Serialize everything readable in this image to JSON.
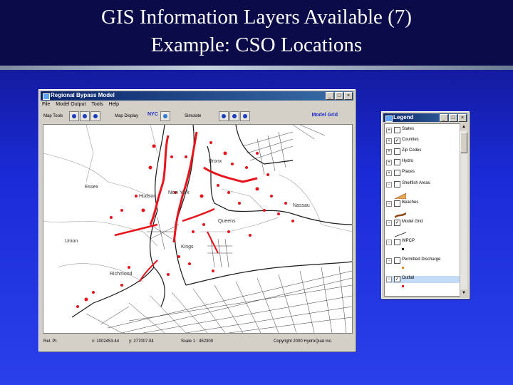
{
  "slide": {
    "title_line1": "GIS Information Layers Available (7)",
    "title_line2": "Example: CSO Locations"
  },
  "app": {
    "window_title": "Regional Bypass Model",
    "menu": [
      "File",
      "Model Output",
      "Tools",
      "Help"
    ],
    "toolbar": {
      "map_tools_label": "Map Tools",
      "map_display_label": "Map Display",
      "map_display_value": "NYC",
      "simulate_label": "Simulate",
      "model_grid": "Model Grid"
    },
    "map_labels": [
      "Bronx",
      "Essex",
      "Hudson",
      "New York",
      "Nassau",
      "Queens",
      "Union",
      "Kings",
      "Richmond"
    ],
    "status": {
      "left": "Rel. Pt.",
      "x": "x: 1002453.44",
      "y": "y: 277007.04",
      "scale": "Scale 1 : 452300",
      "copyright": "Copyright 2000 HydroQual Inc."
    }
  },
  "legend": {
    "title": "Legend",
    "items": [
      {
        "label": "States",
        "checked": false,
        "expanded": false
      },
      {
        "label": "Counties",
        "checked": true,
        "expanded": false
      },
      {
        "label": "Zip Codes",
        "checked": false,
        "expanded": false
      },
      {
        "label": "Hydro",
        "checked": false,
        "expanded": false
      },
      {
        "label": "Places",
        "checked": false,
        "expanded": false
      },
      {
        "label": "Shellfish Areas",
        "checked": false,
        "expanded": true
      },
      {
        "label": "Beaches",
        "checked": false,
        "expanded": true
      },
      {
        "label": "Model Grid",
        "checked": true,
        "expanded": true
      },
      {
        "label": "WPCP",
        "checked": false,
        "expanded": true
      },
      {
        "label": "Permitted Discharge",
        "checked": false,
        "expanded": true
      },
      {
        "label": "Outfall",
        "checked": true,
        "expanded": true
      }
    ]
  },
  "colors": {
    "slide_bg": "#1a2bd6",
    "title_band": "#0b0b4a",
    "cso_dots": "#e8141c",
    "window_face": "#d4d0c8"
  }
}
